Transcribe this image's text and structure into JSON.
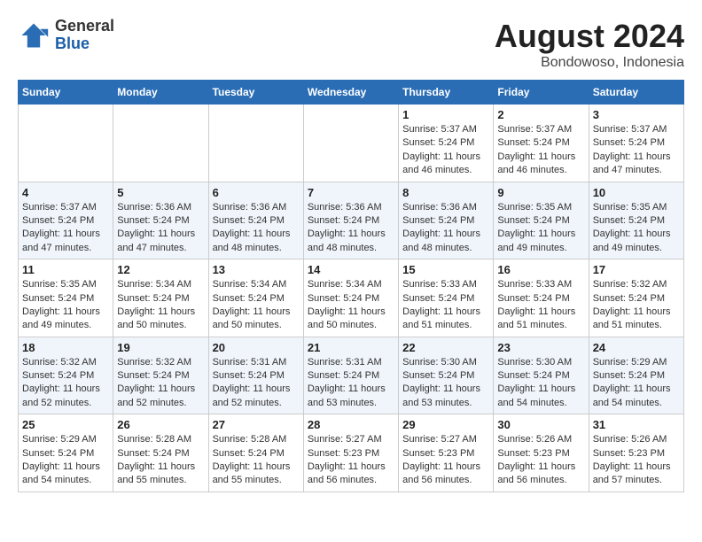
{
  "logo": {
    "general": "General",
    "blue": "Blue"
  },
  "title": "August 2024",
  "subtitle": "Bondowoso, Indonesia",
  "days_header": [
    "Sunday",
    "Monday",
    "Tuesday",
    "Wednesday",
    "Thursday",
    "Friday",
    "Saturday"
  ],
  "weeks": [
    [
      {
        "day": "",
        "sunrise": "",
        "sunset": "",
        "daylight": ""
      },
      {
        "day": "",
        "sunrise": "",
        "sunset": "",
        "daylight": ""
      },
      {
        "day": "",
        "sunrise": "",
        "sunset": "",
        "daylight": ""
      },
      {
        "day": "",
        "sunrise": "",
        "sunset": "",
        "daylight": ""
      },
      {
        "day": "1",
        "sunrise": "Sunrise: 5:37 AM",
        "sunset": "Sunset: 5:24 PM",
        "daylight": "Daylight: 11 hours and 46 minutes."
      },
      {
        "day": "2",
        "sunrise": "Sunrise: 5:37 AM",
        "sunset": "Sunset: 5:24 PM",
        "daylight": "Daylight: 11 hours and 46 minutes."
      },
      {
        "day": "3",
        "sunrise": "Sunrise: 5:37 AM",
        "sunset": "Sunset: 5:24 PM",
        "daylight": "Daylight: 11 hours and 47 minutes."
      }
    ],
    [
      {
        "day": "4",
        "sunrise": "Sunrise: 5:37 AM",
        "sunset": "Sunset: 5:24 PM",
        "daylight": "Daylight: 11 hours and 47 minutes."
      },
      {
        "day": "5",
        "sunrise": "Sunrise: 5:36 AM",
        "sunset": "Sunset: 5:24 PM",
        "daylight": "Daylight: 11 hours and 47 minutes."
      },
      {
        "day": "6",
        "sunrise": "Sunrise: 5:36 AM",
        "sunset": "Sunset: 5:24 PM",
        "daylight": "Daylight: 11 hours and 48 minutes."
      },
      {
        "day": "7",
        "sunrise": "Sunrise: 5:36 AM",
        "sunset": "Sunset: 5:24 PM",
        "daylight": "Daylight: 11 hours and 48 minutes."
      },
      {
        "day": "8",
        "sunrise": "Sunrise: 5:36 AM",
        "sunset": "Sunset: 5:24 PM",
        "daylight": "Daylight: 11 hours and 48 minutes."
      },
      {
        "day": "9",
        "sunrise": "Sunrise: 5:35 AM",
        "sunset": "Sunset: 5:24 PM",
        "daylight": "Daylight: 11 hours and 49 minutes."
      },
      {
        "day": "10",
        "sunrise": "Sunrise: 5:35 AM",
        "sunset": "Sunset: 5:24 PM",
        "daylight": "Daylight: 11 hours and 49 minutes."
      }
    ],
    [
      {
        "day": "11",
        "sunrise": "Sunrise: 5:35 AM",
        "sunset": "Sunset: 5:24 PM",
        "daylight": "Daylight: 11 hours and 49 minutes."
      },
      {
        "day": "12",
        "sunrise": "Sunrise: 5:34 AM",
        "sunset": "Sunset: 5:24 PM",
        "daylight": "Daylight: 11 hours and 50 minutes."
      },
      {
        "day": "13",
        "sunrise": "Sunrise: 5:34 AM",
        "sunset": "Sunset: 5:24 PM",
        "daylight": "Daylight: 11 hours and 50 minutes."
      },
      {
        "day": "14",
        "sunrise": "Sunrise: 5:34 AM",
        "sunset": "Sunset: 5:24 PM",
        "daylight": "Daylight: 11 hours and 50 minutes."
      },
      {
        "day": "15",
        "sunrise": "Sunrise: 5:33 AM",
        "sunset": "Sunset: 5:24 PM",
        "daylight": "Daylight: 11 hours and 51 minutes."
      },
      {
        "day": "16",
        "sunrise": "Sunrise: 5:33 AM",
        "sunset": "Sunset: 5:24 PM",
        "daylight": "Daylight: 11 hours and 51 minutes."
      },
      {
        "day": "17",
        "sunrise": "Sunrise: 5:32 AM",
        "sunset": "Sunset: 5:24 PM",
        "daylight": "Daylight: 11 hours and 51 minutes."
      }
    ],
    [
      {
        "day": "18",
        "sunrise": "Sunrise: 5:32 AM",
        "sunset": "Sunset: 5:24 PM",
        "daylight": "Daylight: 11 hours and 52 minutes."
      },
      {
        "day": "19",
        "sunrise": "Sunrise: 5:32 AM",
        "sunset": "Sunset: 5:24 PM",
        "daylight": "Daylight: 11 hours and 52 minutes."
      },
      {
        "day": "20",
        "sunrise": "Sunrise: 5:31 AM",
        "sunset": "Sunset: 5:24 PM",
        "daylight": "Daylight: 11 hours and 52 minutes."
      },
      {
        "day": "21",
        "sunrise": "Sunrise: 5:31 AM",
        "sunset": "Sunset: 5:24 PM",
        "daylight": "Daylight: 11 hours and 53 minutes."
      },
      {
        "day": "22",
        "sunrise": "Sunrise: 5:30 AM",
        "sunset": "Sunset: 5:24 PM",
        "daylight": "Daylight: 11 hours and 53 minutes."
      },
      {
        "day": "23",
        "sunrise": "Sunrise: 5:30 AM",
        "sunset": "Sunset: 5:24 PM",
        "daylight": "Daylight: 11 hours and 54 minutes."
      },
      {
        "day": "24",
        "sunrise": "Sunrise: 5:29 AM",
        "sunset": "Sunset: 5:24 PM",
        "daylight": "Daylight: 11 hours and 54 minutes."
      }
    ],
    [
      {
        "day": "25",
        "sunrise": "Sunrise: 5:29 AM",
        "sunset": "Sunset: 5:24 PM",
        "daylight": "Daylight: 11 hours and 54 minutes."
      },
      {
        "day": "26",
        "sunrise": "Sunrise: 5:28 AM",
        "sunset": "Sunset: 5:24 PM",
        "daylight": "Daylight: 11 hours and 55 minutes."
      },
      {
        "day": "27",
        "sunrise": "Sunrise: 5:28 AM",
        "sunset": "Sunset: 5:24 PM",
        "daylight": "Daylight: 11 hours and 55 minutes."
      },
      {
        "day": "28",
        "sunrise": "Sunrise: 5:27 AM",
        "sunset": "Sunset: 5:23 PM",
        "daylight": "Daylight: 11 hours and 56 minutes."
      },
      {
        "day": "29",
        "sunrise": "Sunrise: 5:27 AM",
        "sunset": "Sunset: 5:23 PM",
        "daylight": "Daylight: 11 hours and 56 minutes."
      },
      {
        "day": "30",
        "sunrise": "Sunrise: 5:26 AM",
        "sunset": "Sunset: 5:23 PM",
        "daylight": "Daylight: 11 hours and 56 minutes."
      },
      {
        "day": "31",
        "sunrise": "Sunrise: 5:26 AM",
        "sunset": "Sunset: 5:23 PM",
        "daylight": "Daylight: 11 hours and 57 minutes."
      }
    ]
  ]
}
